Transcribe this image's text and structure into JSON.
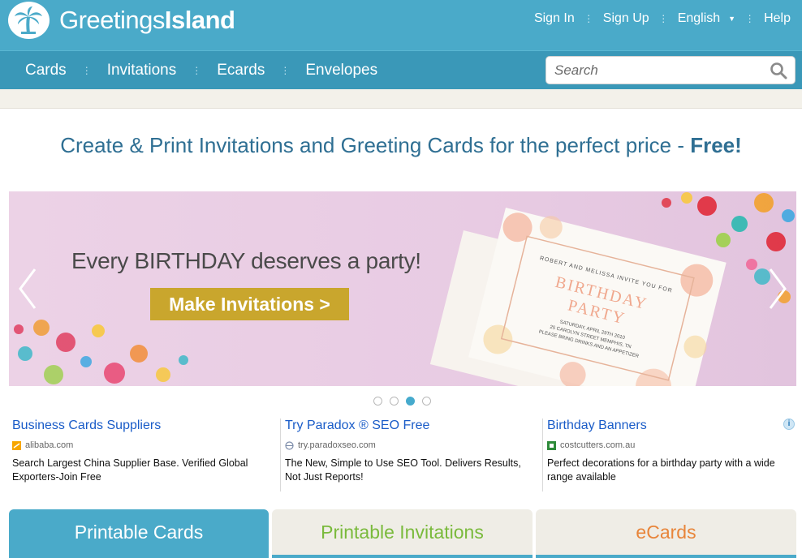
{
  "header": {
    "logo_light": "Greetings",
    "logo_bold": "Island",
    "links": {
      "sign_in": "Sign In",
      "sign_up": "Sign Up",
      "language": "English",
      "help": "Help"
    },
    "separator": "⋮"
  },
  "nav": {
    "items": [
      "Cards",
      "Invitations",
      "Ecards",
      "Envelopes"
    ],
    "separator": "⋮",
    "search_placeholder": "Search"
  },
  "headline": {
    "text": "Create & Print Invitations and Greeting Cards for the perfect price - ",
    "emphasis": "Free!"
  },
  "hero": {
    "tagline": "Every BIRTHDAY deserves a party!",
    "cta": "Make Invitations >",
    "card_text": "ROBERT AND MELISSA INVITE YOU FOR",
    "card_title_1": "BIRTHDAY",
    "card_title_2": "PARTY",
    "card_details_1": "SATURDAY, APRIL 29TH 2010",
    "card_details_2": "25 CAROLYN STREET MEMPHIS, TN",
    "card_details_3": "PLEASE BRING DRINKS AND AN APPETIZER",
    "slides_total": 4,
    "active_slide": 3
  },
  "ads": [
    {
      "title": "Business Cards Suppliers",
      "domain": "alibaba.com",
      "desc": "Search Largest China Supplier Base. Verified Global Exporters-Join Free"
    },
    {
      "title": "Try Paradox ® SEO Free",
      "domain": "try.paradoxseo.com",
      "desc": "The New, Simple to Use SEO Tool. Delivers Results, Not Just Reports!"
    },
    {
      "title": "Birthday Banners",
      "domain": "costcutters.com.au",
      "desc": "Perfect decorations for a birthday party with a wide range available"
    }
  ],
  "tabs": [
    {
      "label": "Printable Cards",
      "color": "#ffffff"
    },
    {
      "label": "Printable Invitations",
      "color": "#7aba3c"
    },
    {
      "label": "eCards",
      "color": "#e8853a"
    }
  ],
  "colors": {
    "brand": "#4aaac9",
    "nav": "#3a98b8",
    "cta": "#c9a62d",
    "headline": "#2f6f93",
    "ad_link": "#1a5cc8"
  }
}
